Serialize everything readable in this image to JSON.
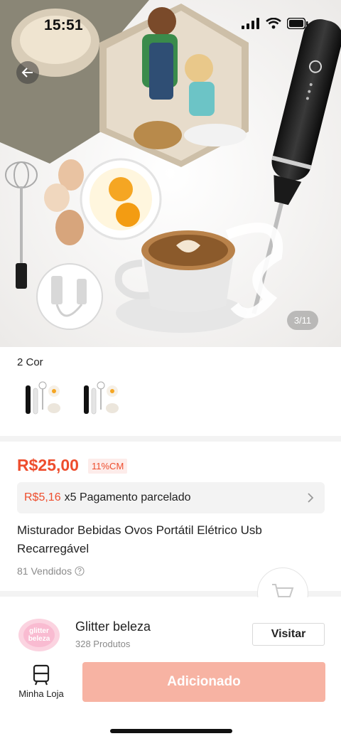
{
  "status_bar": {
    "time": "15:51"
  },
  "gallery": {
    "counter": "3/11"
  },
  "variants": {
    "label": "2 Cor",
    "items": [
      {
        "name": "variant-1"
      },
      {
        "name": "variant-2"
      }
    ]
  },
  "product": {
    "price": "R$25,00",
    "discount": "11%CM",
    "installment_amount": "R$5,16",
    "installment_text": "x5 Pagamento parcelado",
    "title": "Misturador Bebidas Ovos Portátil Elétrico Usb Recarregável",
    "sold": "81 Vendidos"
  },
  "store": {
    "name": "Glitter beleza",
    "product_count": "328 Produtos",
    "logo_text_1": "glitter",
    "logo_text_2": "beleza",
    "visit_label": "Visitar"
  },
  "bottom_bar": {
    "my_store_label": "Minha Loja",
    "add_button_label": "Adicionado"
  },
  "colors": {
    "accent": "#ee4d2d",
    "add_button": "#f7b3a3"
  }
}
